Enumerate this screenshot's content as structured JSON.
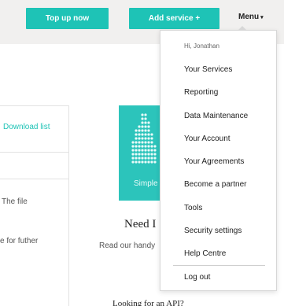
{
  "header": {
    "topup_label": "Top up now",
    "add_service_label": "Add service +",
    "menu_label": "Menu",
    "caret": "▾"
  },
  "left_panel": {
    "download_link": "Download list",
    "file_text": "The file",
    "further_text": "e for futher"
  },
  "guide": {
    "card_label": "Simple",
    "heading": "Need I",
    "description": "Read our handy",
    "bottom_text": "Looking for an API?"
  },
  "menu": {
    "greeting": "Hi, Jonathan",
    "items": [
      {
        "label": "Your Services"
      },
      {
        "label": "Reporting"
      },
      {
        "label": "Data Maintenance"
      },
      {
        "label": "Your Account"
      },
      {
        "label": "Your Agreements"
      },
      {
        "label": "Become a partner"
      },
      {
        "label": "Tools"
      },
      {
        "label": "Security settings"
      },
      {
        "label": "Help Centre"
      }
    ],
    "logout": "Log out"
  },
  "colors": {
    "accent": "#1ec3b6",
    "topbar_bg": "#f1f0ef"
  }
}
